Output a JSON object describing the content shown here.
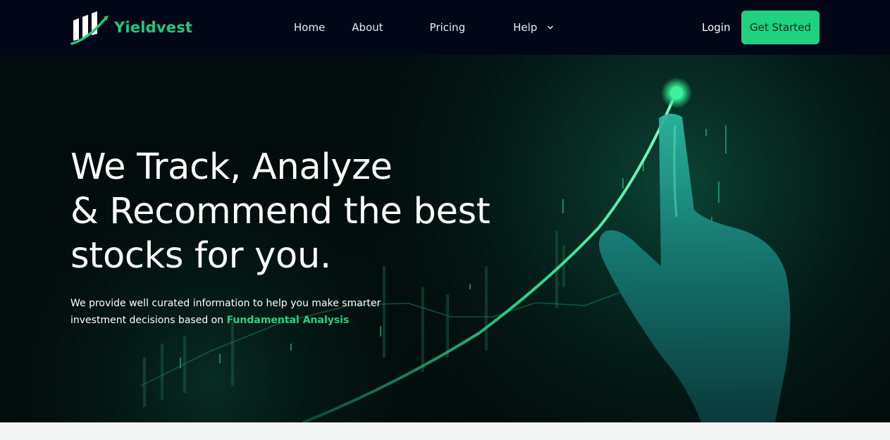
{
  "brand": {
    "name": "Yieldvest",
    "logo_icon": "bar-chart-growth-logo",
    "accent_color": "#20d17f"
  },
  "nav": {
    "items": [
      {
        "label": "Home"
      },
      {
        "label": "About"
      },
      {
        "label": "Pricing"
      },
      {
        "label": "Help",
        "icon": "chevron-down-icon"
      }
    ],
    "login_label": "Login",
    "cta_label": "Get Started"
  },
  "hero": {
    "title_lines": [
      "We Track, Analyze",
      "& Recommend the best",
      "stocks for you."
    ],
    "subtitle_part1": "We provide well curated information to help you make smarter investment decisions based on",
    "subtitle_highlight": "Fundamental Analysis",
    "background_image": "hand-touching-rising-stock-chart"
  }
}
